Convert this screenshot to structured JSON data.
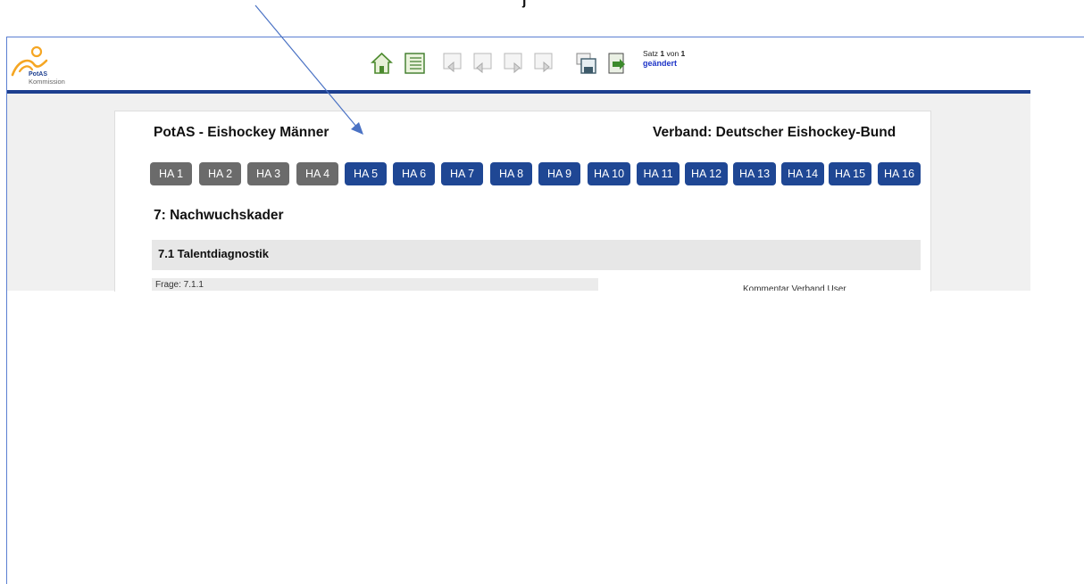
{
  "logo": {
    "brand": "PotAS",
    "subtitle": "Kommission"
  },
  "toolbar": {
    "icons": [
      "home-icon",
      "list-icon",
      "first-record-icon",
      "previous-record-icon",
      "next-record-icon",
      "last-record-icon",
      "save-icon",
      "export-icon"
    ]
  },
  "record": {
    "satz_prefix": "Satz ",
    "current": "1",
    "von": " von ",
    "total": "1",
    "status": "geändert"
  },
  "page": {
    "title_left": "PotAS - Eishockey Männer",
    "title_right": "Verband: Deutscher Eishockey-Bund",
    "section_heading": "7: Nachwuchskader",
    "subsection": "7.1 Talentdiagnostik",
    "question": "Frage: 7.1.1",
    "comment_label": "Kommentar Verband User"
  },
  "ha_tabs": [
    {
      "label": "HA 1",
      "state": "inactive"
    },
    {
      "label": "HA 2",
      "state": "inactive"
    },
    {
      "label": "HA 3",
      "state": "inactive"
    },
    {
      "label": "HA 4",
      "state": "inactive"
    },
    {
      "label": "HA 5",
      "state": "active"
    },
    {
      "label": "HA 6",
      "state": "active"
    },
    {
      "label": "HA 7",
      "state": "active"
    },
    {
      "label": "HA 8",
      "state": "active"
    },
    {
      "label": "HA 9",
      "state": "active"
    },
    {
      "label": "HA 10",
      "state": "active"
    },
    {
      "label": "HA 11",
      "state": "active"
    },
    {
      "label": "HA 12",
      "state": "active"
    },
    {
      "label": "HA 13",
      "state": "active"
    },
    {
      "label": "HA 14",
      "state": "active"
    },
    {
      "label": "HA 15",
      "state": "active"
    },
    {
      "label": "HA 16",
      "state": "active"
    }
  ],
  "colors": {
    "header_bar": "#1d3f8f",
    "tab_active": "#1f4794",
    "tab_inactive": "#6b6b6b",
    "status_text": "#1c33c7",
    "arrow": "#4a72c4",
    "logo_orange": "#f5a623"
  }
}
